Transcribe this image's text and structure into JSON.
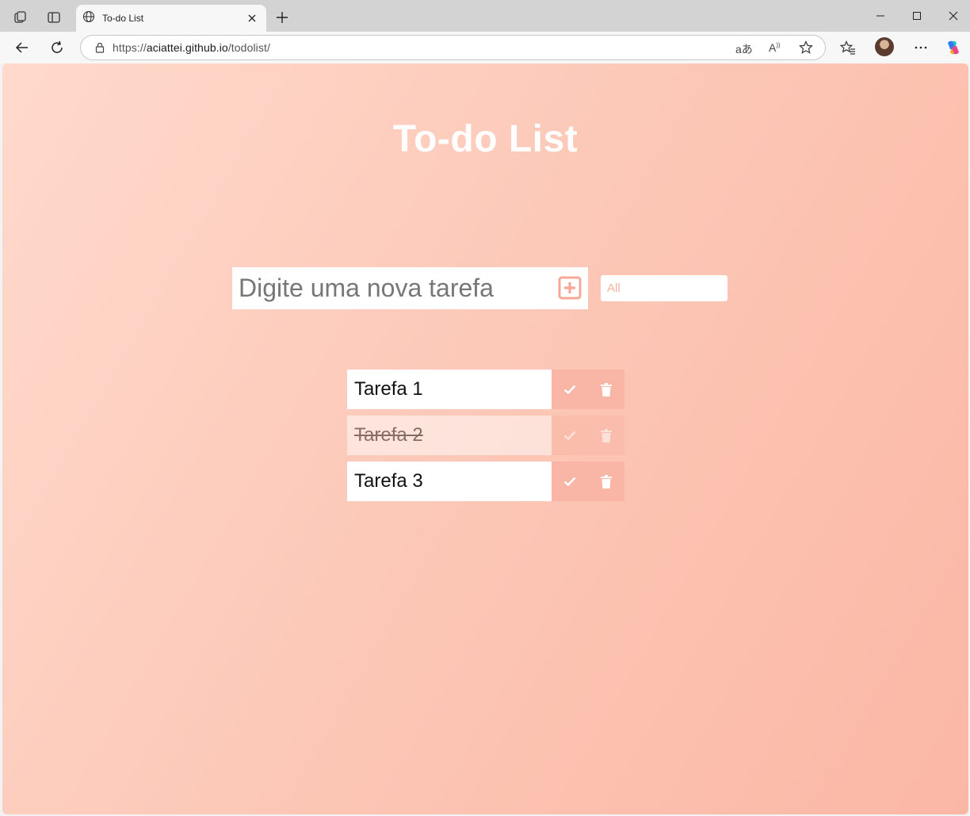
{
  "browser": {
    "tab_title": "To-do List",
    "url_scheme": "https://",
    "url_host": "aciattei.github.io",
    "url_path": "/todolist/"
  },
  "page": {
    "title": "To-do List",
    "input_placeholder": "Digite uma nova tarefa",
    "filter_selected": "All",
    "todos": [
      {
        "text": "Tarefa 1",
        "completed": false
      },
      {
        "text": "Tarefa 2",
        "completed": true
      },
      {
        "text": "Tarefa 3",
        "completed": false
      }
    ]
  },
  "colors": {
    "accent": "#f9b6a6",
    "title_text": "#ffffff"
  },
  "icons": {
    "add": "plus-square-icon",
    "check": "check-icon",
    "delete": "trash-icon"
  }
}
